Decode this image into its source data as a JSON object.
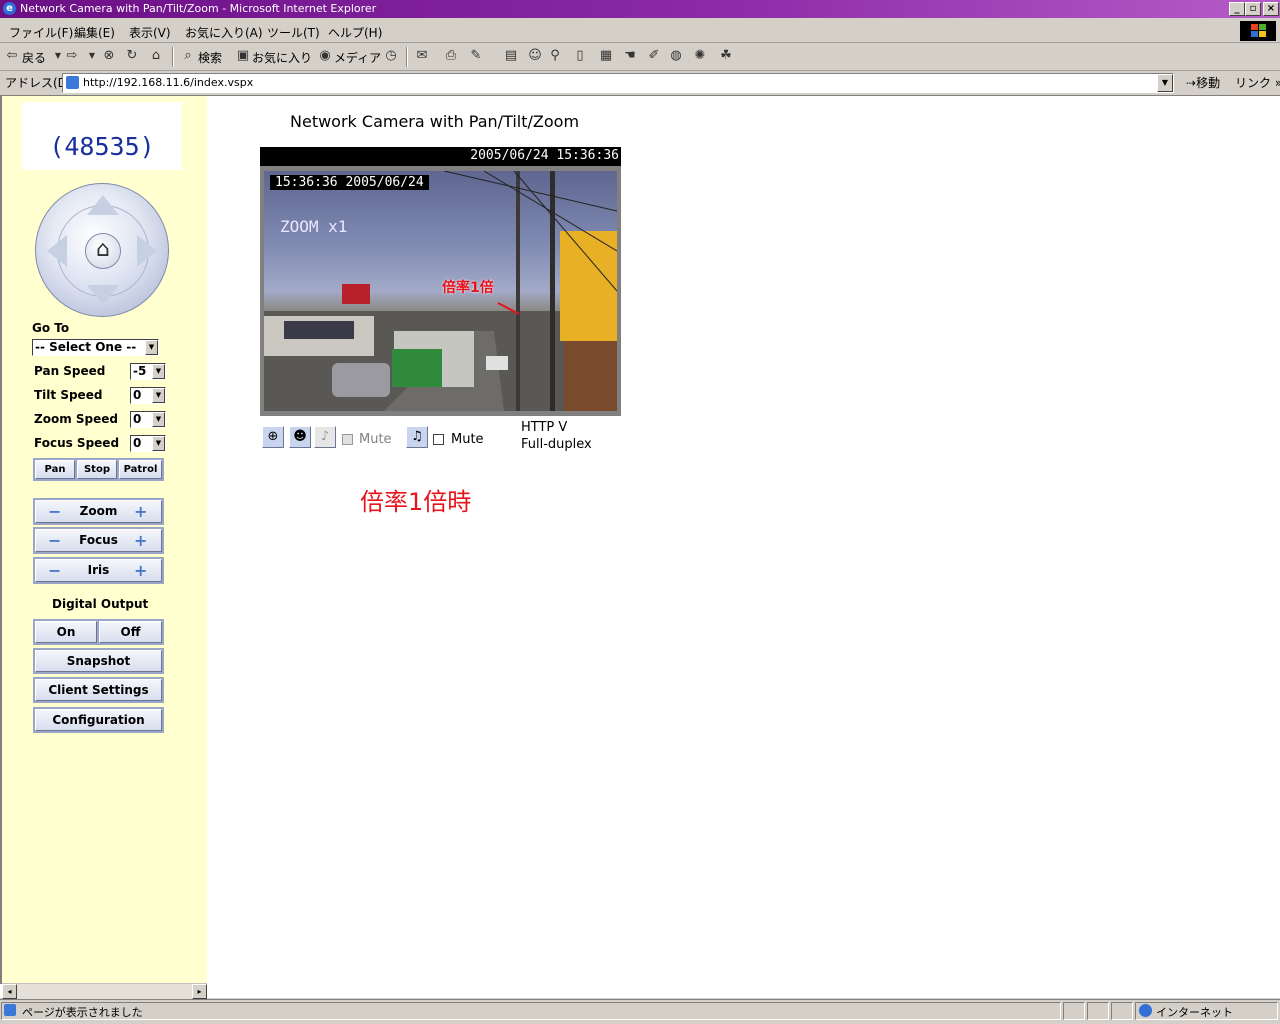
{
  "window": {
    "title": "Network Camera with Pan/Tilt/Zoom - Microsoft Internet Explorer",
    "min": "_",
    "max": "▫",
    "close": "×"
  },
  "menu": [
    "ファイル(F)",
    "編集(E)",
    "表示(V)",
    "お気に入り(A)",
    "ツール(T)",
    "ヘルプ(H)"
  ],
  "toolbar": {
    "back": "戻る",
    "search": "検索",
    "favorites": "お気に入り",
    "media": "メディア"
  },
  "address": {
    "label": "アドレス(D)",
    "url": "http://192.168.11.6/index.vspx",
    "go": "移動",
    "links": "リンク"
  },
  "sidebar": {
    "camera_id": "(48535)",
    "goto_label": "Go To",
    "goto_value": "-- Select One --",
    "speeds": [
      {
        "label": "Pan Speed",
        "value": "-5"
      },
      {
        "label": "Tilt Speed",
        "value": "0"
      },
      {
        "label": "Zoom Speed",
        "value": "0"
      },
      {
        "label": "Focus Speed",
        "value": "0"
      }
    ],
    "motion": {
      "pan": "Pan",
      "stop": "Stop",
      "patrol": "Patrol"
    },
    "adjust": {
      "zoom": "Zoom",
      "focus": "Focus",
      "iris": "Iris",
      "minus": "−",
      "plus": "+"
    },
    "digital_output": "Digital Output",
    "on": "On",
    "off": "Off",
    "snapshot": "Snapshot",
    "client_settings": "Client Settings",
    "configuration": "Configuration"
  },
  "main": {
    "title": "Network Camera with Pan/Tilt/Zoom",
    "video_header_time": "2005/06/24 15:36:36",
    "osd_time": "15:36:36  2005/06/24",
    "osd_zoom": "ZOOM x1",
    "overlay_label": "倍率1倍",
    "mute1": "Mute",
    "mute2": "Mute",
    "protocol": "HTTP    V",
    "duplex": "Full-duplex",
    "caption": "倍率1倍時"
  },
  "status": {
    "text": "ページが表示されました",
    "zone": "インターネット"
  }
}
